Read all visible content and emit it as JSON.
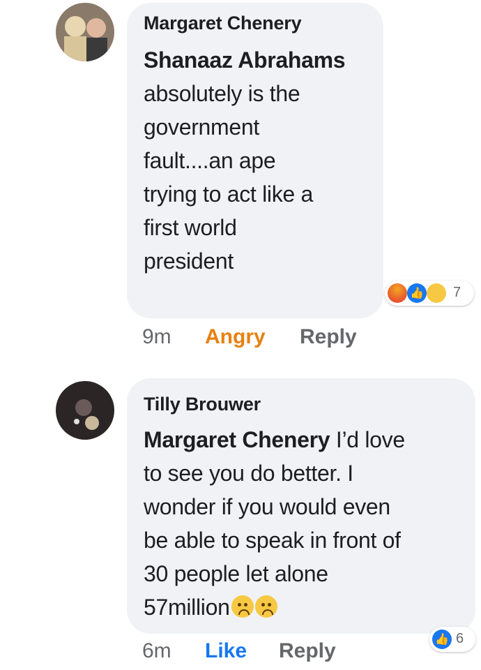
{
  "comments": [
    {
      "author": "Margaret Chenery",
      "mention": "Shanaaz Abrahams",
      "text_lines": [
        "absolutely is the",
        "government",
        "fault....an ape",
        "trying to act like a",
        "first world",
        "president"
      ],
      "reaction_count": "7",
      "reaction_icons": [
        "angry-reaction-icon",
        "like-reaction-icon",
        "wow-reaction-icon"
      ],
      "time": "9m",
      "reaction_label": "Angry",
      "reply_label": "Reply"
    },
    {
      "author": "Tilly Brouwer",
      "mention": "Margaret Chenery",
      "text_first": " I’d love",
      "text_lines": [
        "to see you do better.  I",
        "wonder if you would even",
        "be able to speak in front of",
        "30 people let alone"
      ],
      "text_last": "57million",
      "inline_emoji": [
        "worried-face-icon",
        "worried-face-icon"
      ],
      "reaction_count": "6",
      "reaction_icons": [
        "like-reaction-icon"
      ],
      "time": "6m",
      "reaction_label": "Like",
      "reply_label": "Reply"
    }
  ]
}
